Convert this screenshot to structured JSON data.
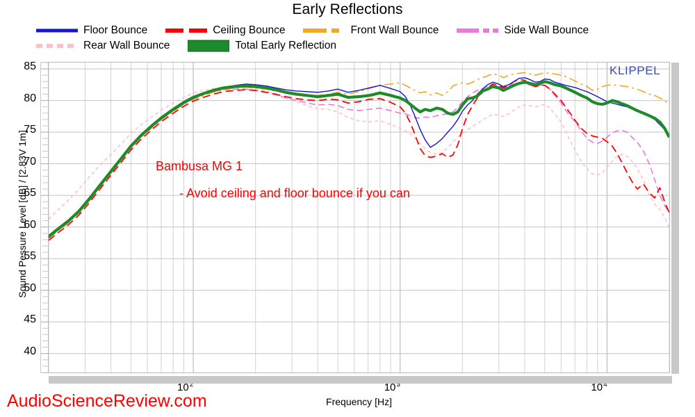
{
  "chart_data": {
    "type": "line",
    "title": "Early Reflections",
    "xlabel": "Frequency [Hz]",
    "ylabel": "Sound Pessure Level [dB] / [2.83V 1m]",
    "xscale": "log",
    "xlim": [
      20,
      20000
    ],
    "ylim": [
      37,
      86
    ],
    "yticks": [
      40,
      45,
      50,
      55,
      60,
      65,
      70,
      75,
      80,
      85
    ],
    "xticks": [
      100,
      1000,
      10000
    ],
    "xtick_labels": [
      "10 2",
      "10 3",
      "10 4"
    ],
    "grid": true,
    "legend_position": "top",
    "watermarks": [
      "KLIPPEL",
      "AudioScienceReview.com"
    ],
    "annotations": [
      {
        "text": "Bambusa MG 1",
        "color": "#ff0000"
      },
      {
        "text": "- Avoid ceiling and floor bounce if you can",
        "color": "#ff0000"
      }
    ],
    "series": [
      {
        "name": "Floor Bounce",
        "color": "#1515cf",
        "dash": "solid",
        "width": 1.4,
        "x": [
          20,
          22,
          25,
          28,
          31,
          35,
          40,
          45,
          50,
          56,
          63,
          71,
          80,
          90,
          100,
          112,
          125,
          140,
          160,
          180,
          200,
          225,
          250,
          280,
          315,
          355,
          400,
          450,
          500,
          560,
          630,
          710,
          800,
          900,
          1000,
          1060,
          1120,
          1180,
          1250,
          1320,
          1400,
          1500,
          1600,
          1700,
          1800,
          1900,
          2000,
          2120,
          2240,
          2360,
          2500,
          2650,
          2800,
          3000,
          3150,
          3350,
          3550,
          3750,
          4000,
          4250,
          4500,
          4750,
          5000,
          5300,
          5600,
          6000,
          6300,
          6700,
          7100,
          7500,
          8000,
          8500,
          9000,
          9500,
          10000,
          10600,
          11200,
          11800,
          12500,
          13200,
          14000,
          15000,
          16000,
          17000,
          18000,
          19000,
          20000
        ],
        "y": [
          58.3,
          59.4,
          60.8,
          62.3,
          64.0,
          66.2,
          68.6,
          70.7,
          72.6,
          74.3,
          75.8,
          77.2,
          78.4,
          79.5,
          80.3,
          81.0,
          81.6,
          82.1,
          82.4,
          82.6,
          82.5,
          82.3,
          82.0,
          81.7,
          81.5,
          81.4,
          81.3,
          81.5,
          81.8,
          81.3,
          81.6,
          82.0,
          82.4,
          81.9,
          81.4,
          80.6,
          79.2,
          77.5,
          75.4,
          73.8,
          72.6,
          73.2,
          74.0,
          75.0,
          75.9,
          77.0,
          78.3,
          79.3,
          80.0,
          81.0,
          81.8,
          82.5,
          82.9,
          82.6,
          82.2,
          82.5,
          83.0,
          83.5,
          83.6,
          83.3,
          82.9,
          83.0,
          83.4,
          83.3,
          82.9,
          82.6,
          82.4,
          82.2,
          82.0,
          81.7,
          81.4,
          81.0,
          80.6,
          80.2,
          79.8,
          79.6,
          79.4,
          79.2,
          79.0,
          78.7,
          78.4,
          78.0,
          77.5,
          77.0,
          76.2,
          75.4,
          74.6
        ]
      },
      {
        "name": "Ceiling Bounce",
        "color": "#ff0000",
        "dash": "dashed",
        "width": 1.8,
        "x": [
          20,
          22,
          25,
          28,
          31,
          35,
          40,
          45,
          50,
          56,
          63,
          71,
          80,
          90,
          100,
          112,
          125,
          140,
          160,
          180,
          200,
          225,
          250,
          280,
          315,
          355,
          400,
          450,
          500,
          560,
          630,
          710,
          800,
          900,
          1000,
          1060,
          1120,
          1180,
          1250,
          1320,
          1400,
          1500,
          1600,
          1700,
          1800,
          1900,
          2000,
          2120,
          2240,
          2360,
          2500,
          2650,
          2800,
          3000,
          3150,
          3350,
          3550,
          3750,
          4000,
          4250,
          4500,
          4750,
          5000,
          5300,
          5600,
          6000,
          6300,
          6700,
          7100,
          7500,
          8000,
          8500,
          9000,
          9500,
          10000,
          10600,
          11200,
          11800,
          12500,
          13200,
          14000,
          15000,
          16000,
          17000,
          18000,
          19000,
          20000
        ],
        "y": [
          57.9,
          59.0,
          60.4,
          61.9,
          63.6,
          65.8,
          68.2,
          70.3,
          72.2,
          73.9,
          75.4,
          76.8,
          78.0,
          79.1,
          79.9,
          80.5,
          81.0,
          81.4,
          81.6,
          81.7,
          81.6,
          81.3,
          81.0,
          80.6,
          80.3,
          80.1,
          80.0,
          80.2,
          80.1,
          79.6,
          79.8,
          80.2,
          80.3,
          79.7,
          79.0,
          78.0,
          76.5,
          74.6,
          72.4,
          71.3,
          71.0,
          71.2,
          71.6,
          71.0,
          71.4,
          73.0,
          75.5,
          77.8,
          79.2,
          80.4,
          81.3,
          82.0,
          82.6,
          82.4,
          82.0,
          82.4,
          83.0,
          83.3,
          83.2,
          82.6,
          82.2,
          82.4,
          82.4,
          81.8,
          81.0,
          80.0,
          79.0,
          77.8,
          76.6,
          75.6,
          74.8,
          74.4,
          74.2,
          74.0,
          73.5,
          72.8,
          71.6,
          70.2,
          68.6,
          67.2,
          66.0,
          66.8,
          65.4,
          64.6,
          66.2,
          64.0,
          62.2
        ]
      },
      {
        "name": "Front Wall Bounce",
        "color": "#f5a623",
        "dash": "dashdot",
        "width": 1.6,
        "x": [
          20,
          22,
          25,
          28,
          31,
          35,
          40,
          45,
          50,
          56,
          63,
          71,
          80,
          90,
          100,
          112,
          125,
          140,
          160,
          180,
          200,
          225,
          250,
          280,
          315,
          355,
          400,
          450,
          500,
          560,
          630,
          710,
          800,
          900,
          1000,
          1060,
          1120,
          1180,
          1250,
          1320,
          1400,
          1500,
          1600,
          1700,
          1800,
          1900,
          2000,
          2120,
          2240,
          2360,
          2500,
          2650,
          2800,
          3000,
          3150,
          3350,
          3550,
          3750,
          4000,
          4250,
          4500,
          4750,
          5000,
          5300,
          5600,
          6000,
          6300,
          6700,
          7100,
          7500,
          8000,
          8500,
          9000,
          9500,
          10000,
          10600,
          11200,
          11800,
          12500,
          13200,
          14000,
          15000,
          16000,
          17000,
          18000,
          19000,
          20000
        ],
        "y": [
          58.2,
          59.3,
          60.7,
          62.2,
          63.9,
          66.1,
          68.5,
          70.6,
          72.5,
          74.2,
          75.7,
          77.1,
          78.3,
          79.4,
          80.2,
          80.8,
          81.3,
          81.7,
          82.0,
          82.1,
          82.0,
          81.8,
          81.5,
          81.2,
          81.0,
          80.9,
          80.8,
          81.0,
          81.3,
          81.0,
          81.4,
          81.9,
          82.4,
          82.6,
          82.8,
          82.4,
          82.0,
          81.6,
          81.2,
          81.4,
          80.9,
          81.2,
          80.8,
          81.4,
          82.3,
          82.6,
          82.8,
          82.6,
          82.9,
          83.3,
          83.6,
          83.9,
          84.2,
          84.0,
          83.6,
          84.0,
          84.2,
          84.3,
          84.4,
          84.2,
          84.0,
          84.2,
          84.4,
          84.3,
          84.2,
          84.0,
          83.8,
          83.4,
          83.0,
          82.6,
          82.2,
          81.6,
          81.8,
          82.2,
          82.4,
          82.5,
          82.4,
          82.3,
          82.2,
          82.0,
          81.8,
          81.4,
          81.0,
          80.8,
          80.4,
          80.0,
          79.3
        ]
      },
      {
        "name": "Side Wall Bounce",
        "color": "#ee77dd",
        "dash": "dash2",
        "width": 1.6,
        "x": [
          20,
          22,
          25,
          28,
          31,
          35,
          40,
          45,
          50,
          56,
          63,
          71,
          80,
          90,
          100,
          112,
          125,
          140,
          160,
          180,
          200,
          225,
          250,
          280,
          315,
          355,
          400,
          450,
          500,
          560,
          630,
          710,
          800,
          900,
          1000,
          1060,
          1120,
          1180,
          1250,
          1320,
          1400,
          1500,
          1600,
          1700,
          1800,
          1900,
          2000,
          2120,
          2240,
          2360,
          2500,
          2650,
          2800,
          3000,
          3150,
          3350,
          3550,
          3750,
          4000,
          4250,
          4500,
          4750,
          5000,
          5300,
          5600,
          6000,
          6300,
          6700,
          7100,
          7500,
          8000,
          8500,
          9000,
          9500,
          10000,
          10600,
          11200,
          11800,
          12500,
          13200,
          14000,
          15000,
          16000,
          17000,
          18000,
          19000,
          20000
        ],
        "y": [
          58.4,
          59.5,
          60.9,
          62.4,
          64.1,
          66.3,
          68.7,
          70.8,
          72.7,
          74.4,
          75.9,
          77.3,
          78.5,
          79.6,
          80.4,
          81.0,
          81.4,
          81.7,
          81.8,
          81.8,
          81.6,
          81.3,
          80.9,
          80.4,
          80.0,
          79.6,
          79.3,
          79.4,
          79.2,
          78.6,
          78.4,
          78.6,
          78.8,
          78.4,
          78.0,
          77.9,
          77.6,
          77.3,
          77.2,
          77.4,
          77.3,
          77.6,
          77.8,
          77.9,
          78.2,
          78.9,
          79.8,
          80.6,
          81.2,
          81.6,
          81.9,
          82.2,
          82.5,
          82.3,
          82.0,
          82.3,
          82.6,
          82.8,
          82.7,
          82.4,
          82.2,
          82.4,
          82.5,
          81.8,
          80.8,
          79.6,
          78.5,
          77.4,
          76.4,
          75.2,
          74.0,
          73.4,
          73.2,
          73.6,
          74.2,
          74.9,
          75.2,
          75.3,
          75.0,
          74.2,
          73.4,
          72.0,
          70.0,
          67.5,
          65.0,
          63.4,
          62.2
        ]
      },
      {
        "name": "Rear Wall Bounce",
        "color": "#ffc0cb",
        "dash": "dotted",
        "width": 1.6,
        "x": [
          20,
          22,
          25,
          28,
          31,
          35,
          40,
          45,
          50,
          56,
          63,
          71,
          80,
          90,
          100,
          112,
          125,
          140,
          160,
          180,
          200,
          225,
          250,
          280,
          315,
          355,
          400,
          450,
          500,
          560,
          630,
          710,
          800,
          900,
          1000,
          1060,
          1120,
          1180,
          1250,
          1320,
          1400,
          1500,
          1600,
          1700,
          1800,
          1900,
          2000,
          2120,
          2240,
          2360,
          2500,
          2650,
          2800,
          3000,
          3150,
          3350,
          3550,
          3750,
          4000,
          4250,
          4500,
          4750,
          5000,
          5300,
          5600,
          6000,
          6300,
          6700,
          7100,
          7500,
          8000,
          8500,
          9000,
          9500,
          10000,
          10600,
          11200,
          11800,
          12500,
          13200,
          14000,
          15000,
          16000,
          17000,
          18000,
          19000,
          20000
        ],
        "y": [
          61.2,
          62.6,
          64.3,
          66.0,
          67.7,
          69.6,
          71.5,
          73.2,
          74.8,
          76.2,
          77.4,
          78.6,
          79.6,
          80.5,
          81.2,
          81.6,
          81.9,
          82.1,
          82.2,
          82.1,
          81.9,
          81.5,
          81.0,
          80.4,
          79.8,
          79.2,
          78.7,
          78.6,
          78.2,
          77.3,
          76.8,
          76.6,
          76.8,
          76.2,
          75.6,
          75.2,
          74.8,
          74.1,
          73.2,
          72.4,
          71.8,
          71.5,
          71.8,
          72.6,
          73.4,
          74.2,
          74.8,
          75.4,
          75.9,
          76.4,
          76.9,
          77.4,
          77.8,
          77.7,
          77.5,
          77.9,
          78.5,
          79.0,
          79.3,
          79.2,
          79.0,
          79.2,
          79.4,
          78.8,
          77.8,
          76.6,
          75.2,
          73.4,
          71.8,
          70.4,
          69.2,
          68.4,
          68.2,
          68.6,
          69.4,
          70.4,
          71.2,
          71.5,
          71.2,
          70.4,
          69.2,
          67.4,
          65.0,
          63.6,
          62.8,
          61.5,
          59.8
        ]
      },
      {
        "name": "Total Early Reflection",
        "color": "#1d8b2b",
        "dash": "solid",
        "width": 4.2,
        "x": [
          20,
          22,
          25,
          28,
          31,
          35,
          40,
          45,
          50,
          56,
          63,
          71,
          80,
          90,
          100,
          112,
          125,
          140,
          160,
          180,
          200,
          225,
          250,
          280,
          315,
          355,
          400,
          450,
          500,
          560,
          630,
          710,
          800,
          900,
          1000,
          1060,
          1120,
          1180,
          1250,
          1320,
          1400,
          1500,
          1600,
          1700,
          1800,
          1900,
          2000,
          2120,
          2240,
          2360,
          2500,
          2650,
          2800,
          3000,
          3150,
          3350,
          3550,
          3750,
          4000,
          4250,
          4500,
          4750,
          5000,
          5300,
          5600,
          6000,
          6300,
          6700,
          7100,
          7500,
          8000,
          8500,
          9000,
          9500,
          10000,
          10600,
          11200,
          11800,
          12500,
          13200,
          14000,
          15000,
          16000,
          17000,
          18000,
          19000,
          20000
        ],
        "y": [
          58.5,
          59.6,
          61.0,
          62.5,
          64.2,
          66.4,
          68.8,
          70.9,
          72.8,
          74.5,
          76.0,
          77.4,
          78.6,
          79.7,
          80.5,
          81.1,
          81.6,
          82.0,
          82.2,
          82.3,
          82.2,
          82.0,
          81.7,
          81.3,
          81.0,
          80.8,
          80.6,
          80.8,
          81.0,
          80.5,
          80.6,
          80.8,
          81.2,
          80.8,
          80.4,
          80.0,
          79.4,
          78.8,
          78.2,
          78.6,
          78.4,
          78.8,
          78.6,
          78.0,
          77.8,
          78.2,
          79.3,
          80.3,
          80.4,
          80.7,
          81.5,
          81.8,
          82.2,
          82.0,
          81.6,
          82.0,
          82.4,
          82.7,
          82.9,
          82.7,
          82.5,
          82.7,
          83.0,
          82.8,
          82.5,
          82.3,
          82.0,
          81.6,
          81.2,
          80.8,
          80.4,
          79.8,
          79.5,
          79.4,
          79.6,
          80.0,
          79.8,
          79.5,
          79.2,
          78.8,
          78.4,
          78.0,
          77.6,
          77.2,
          76.6,
          75.6,
          74.2
        ]
      }
    ]
  },
  "legend": {
    "rows": [
      [
        {
          "label": "Floor Bounce",
          "color": "#1515cf",
          "dash": "solid"
        },
        {
          "label": "Ceiling Bounce",
          "color": "#ff0000",
          "dash": "dashed"
        },
        {
          "label": "Front Wall Bounce",
          "color": "#f5a623",
          "dash": "dashdot"
        },
        {
          "label": "Side Wall Bounce",
          "color": "#ee77dd",
          "dash": "dash2"
        }
      ],
      [
        {
          "label": "Rear Wall Bounce",
          "color": "#ffc0cb",
          "dash": "dotted"
        },
        {
          "label": "Total Early Reflection",
          "color": "#1d8b2b",
          "dash": "thick"
        }
      ]
    ]
  },
  "axis": {
    "ytick_labels": [
      "85",
      "80",
      "75",
      "70",
      "65",
      "60",
      "55",
      "50",
      "45",
      "40"
    ],
    "xtick_labels": [
      {
        "base": "10",
        "exp": "2"
      },
      {
        "base": "10",
        "exp": "3"
      },
      {
        "base": "10",
        "exp": "4"
      }
    ]
  },
  "colors": {
    "floor": "#1515cf",
    "ceiling": "#ff0000",
    "front_wall": "#f5a623",
    "side_wall": "#ee77dd",
    "rear_wall": "#ffc0cb",
    "total": "#1d8b2b",
    "klippel": "#3b4fa8",
    "asr": "#ff0000",
    "grid": "#c9c9c9",
    "frame": "#b9b9b9"
  }
}
